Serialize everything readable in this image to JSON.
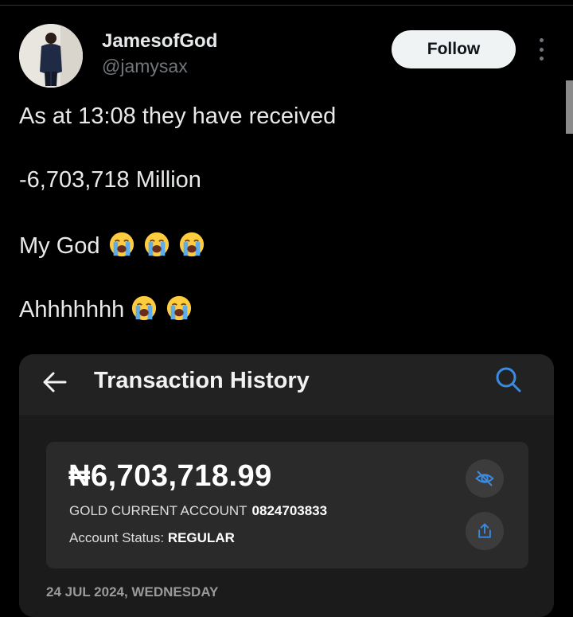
{
  "user": {
    "display_name": "JamesofGod",
    "handle": "@jamysax",
    "follow_label": "Follow"
  },
  "tweet": {
    "lines": [
      "As at 13:08 they have received",
      "-6,703,718 Million",
      "My God",
      "Ahhhhhhh"
    ],
    "emojis": [
      "loudly-crying-face"
    ]
  },
  "embed": {
    "title": "Transaction History",
    "balance": "₦6,703,718.99",
    "account_type": "GOLD CURRENT ACCOUNT",
    "account_number": "0824703833",
    "status_label": "Account Status:",
    "status_value": "REGULAR",
    "date": "24 JUL 2024, WEDNESDAY"
  },
  "colors": {
    "background": "#000000",
    "text": "#e7e9ea",
    "muted": "#71767b",
    "accent_blue": "#3a8be0"
  }
}
